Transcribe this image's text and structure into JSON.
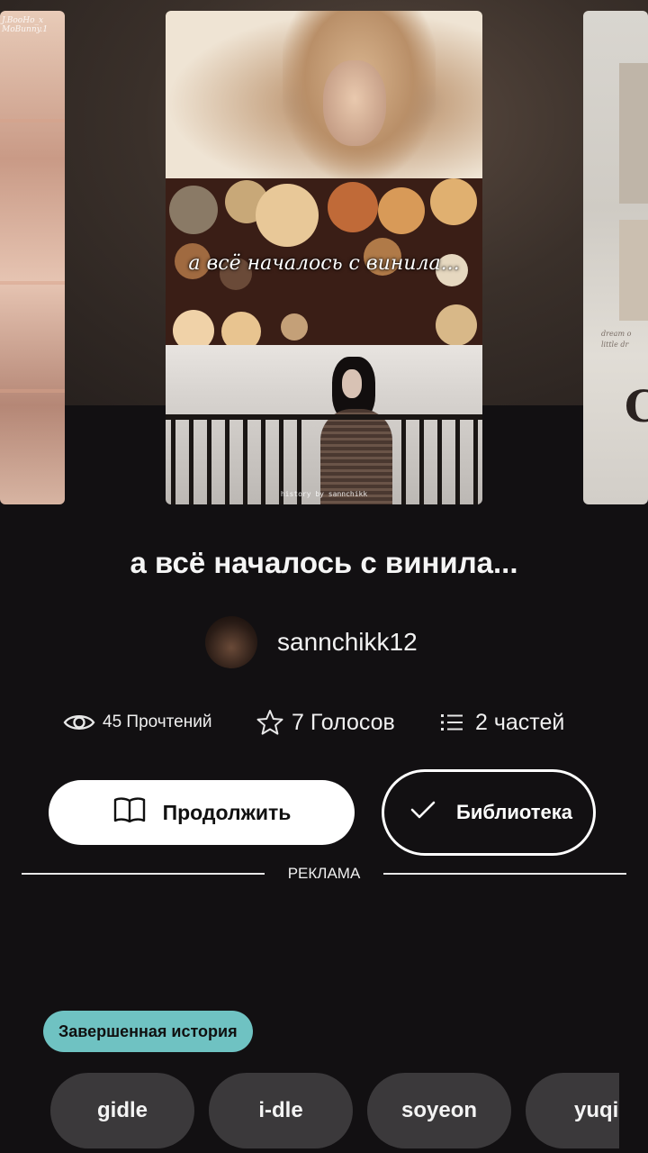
{
  "cover": {
    "overlay_text": "а всё началось с винила...",
    "credit": "history by sannchikk"
  },
  "side_left": {
    "corner_text": "J.BooHo_x\nMoBunny.1"
  },
  "side_right": {
    "big_letter": "C",
    "small_text_1": "dream o",
    "small_text_2": "little dr"
  },
  "story": {
    "title": "а всё началось с винила...",
    "author": "sannchikk12"
  },
  "stats": {
    "reads": "45 Прочтений",
    "votes": "7 Голосов",
    "parts": "2 частей"
  },
  "buttons": {
    "continue": "Продолжить",
    "library": "Библиотека"
  },
  "ad_label": "РЕКЛАМА",
  "status_badge": "Завершенная история",
  "tags": [
    "gidle",
    "i-dle",
    "soyeon",
    "yuqi"
  ],
  "icons": {
    "reads": "eye-icon",
    "votes": "star-icon",
    "parts": "list-icon",
    "continue": "book-icon",
    "library": "check-icon"
  },
  "colors": {
    "background": "#121012",
    "badge": "#6fc2c2",
    "tag_pill": "#3b393b"
  }
}
